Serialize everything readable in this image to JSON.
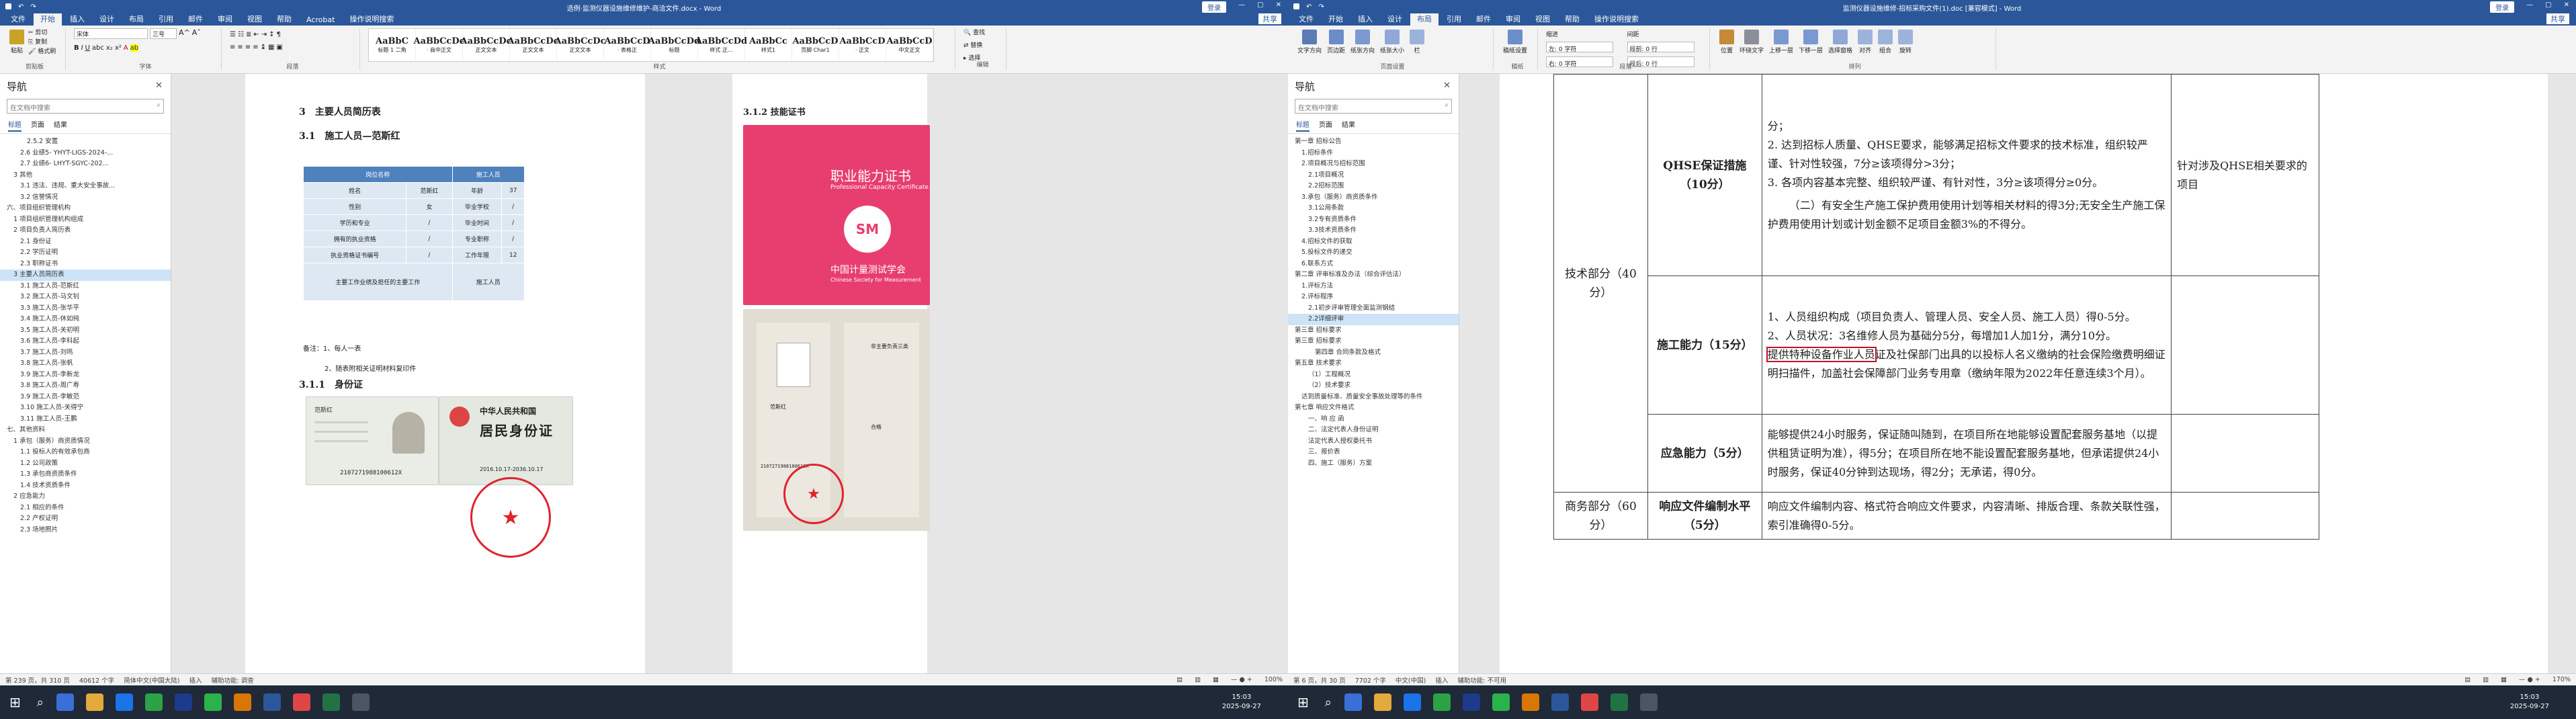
{
  "left": {
    "title": "选例·监测仪器设施维修维护-商洽文件.docx - Word",
    "login": "登录",
    "menu": [
      "文件",
      "开始",
      "插入",
      "设计",
      "布局",
      "引用",
      "邮件",
      "审阅",
      "视图",
      "帮助",
      "Acrobat",
      "操作说明搜索"
    ],
    "share": "共享",
    "ribbon": {
      "paste": "粘贴",
      "cut": "剪切",
      "copy": "复制",
      "painter": "格式刷",
      "font": "宋体",
      "size": "三号",
      "groups": [
        "剪贴板",
        "字体",
        "段落",
        "样式",
        "编辑"
      ],
      "styles": [
        [
          "AaBbC",
          "标题 1 二角"
        ],
        [
          "AaBbCcDc",
          "· 商中正文"
        ],
        [
          "AaBbCcDc",
          "正文文本"
        ],
        [
          "AaBbCcDc",
          "正文文本"
        ],
        [
          "AaBbCcDc",
          "正文文本"
        ],
        [
          "AaBbCcD",
          "· 表格正"
        ],
        [
          "AaBbCcDd",
          "标题"
        ],
        [
          "AaBbCcDd",
          "样式 正..."
        ],
        [
          "AaBbCc",
          "样式1"
        ],
        [
          "AaBbCcD",
          "页脚 Char1"
        ],
        [
          "AaBbCcD",
          "· 正文"
        ],
        [
          "AaBbCcD",
          "中文正文"
        ]
      ],
      "find": "查找",
      "replace": "替换",
      "select": "选择"
    },
    "nav": {
      "title": "导航",
      "search": "在文档中搜索",
      "tabs": [
        "标题",
        "页面",
        "结果"
      ],
      "items": [
        "2.5.2 安置",
        "2.6 业绩5- YHYT-LIGS-2024-...",
        "2.7 业绩6- LHYT-SGYC-202...",
        "3 其他",
        "3.1 违法、违规、重大安全事故...",
        "3.2 信誉情况",
        "六、项目组织管理机构",
        "1 项目组织管理机构组成",
        "2 项目负责人简历表",
        "2.1 身份证",
        "2.2 学历证明",
        "2.3 职称证书",
        "3 主要人员简历表",
        "3.1 施工人员-范斯红",
        "3.2 施工人员-马文钊",
        "3.3 施工人员-张华平",
        "3.4 施工人员-休如纯",
        "3.5 施工人员-关初明",
        "3.6 施工人员-李科起",
        "3.7 施工人员-刘鸣",
        "3.8 施工人员-张帆",
        "3.9 施工人员-李新龙",
        "3.8 施工人员-周广寿",
        "3.9 施工人员-李敏范",
        "3.10 施工人员-关得宁",
        "3.11 施工人员-王鹏",
        "七、其他资料",
        "1 承包（服务）商资质情况",
        "1.1 投标人的有效承包商",
        "1.2 公司政策",
        "1.3 承包商资质条件",
        "1.4 技术资质条件",
        "2 应急能力",
        "2.1 相应的条件",
        "2.2 产权证明",
        "2.3 场地照片"
      ]
    },
    "doc": {
      "h_main": "3　主要人员简历表",
      "h_sub": "3.1　施工人员—范斯红",
      "table": {
        "head": [
          "岗位名称",
          "施工人员"
        ],
        "rows": [
          [
            "姓名",
            "范斯红",
            "年龄",
            "37"
          ],
          [
            "性别",
            "女",
            "毕业学校",
            "/"
          ],
          [
            "学历和专业",
            "/",
            "毕业时间",
            "/"
          ],
          [
            "拥有的执业资格",
            "/",
            "专业职称",
            "/"
          ],
          [
            "执业资格证书编号",
            "/",
            "工作年限",
            "12"
          ]
        ],
        "last": [
          "主要工作业绩及担任的主要工作",
          "施工人员"
        ]
      },
      "note": "备注：1、每人一表",
      "note2": "2、随表附相关证明材料复印件",
      "h_id": "3.1.1　身份证",
      "id_card": {
        "name": "范斯红",
        "nation": "中华人民共和国",
        "title": "居民身份证",
        "id": "2107271988100612X",
        "period": "2016.10.17-2036.10.17"
      },
      "h_cert": "3.1.2 技能证书",
      "cert": {
        "title": "职业能力证书",
        "subtitle": "Professional Capacity Certificate",
        "org": "中国计量测试学会",
        "org_en": "Chinese Society for Measurement",
        "name": "范斯红",
        "type": "非主要负责三类",
        "grade": "合格",
        "no": "2107271988100612X"
      }
    },
    "status": {
      "page": "第 239 页，共 310 页",
      "words": "40612 个字",
      "lang": "简体中文(中国大陆)",
      "ins": "插入",
      "access": "辅助功能: 调查",
      "zoom": "100%"
    }
  },
  "right": {
    "title": "监测仪器设施维修-招标采购文件(1).doc [兼容模式] - Word",
    "menu": [
      "文件",
      "开始",
      "插入",
      "设计",
      "布局",
      "引用",
      "邮件",
      "审阅",
      "视图",
      "帮助",
      "操作说明搜索"
    ],
    "ribbon": {
      "groups": [
        "页面设置",
        "稿纸",
        "段落",
        "排列"
      ],
      "btns": [
        "文字方向",
        "页边距",
        "纸张方向",
        "纸张大小",
        "栏",
        "稿纸设置",
        "位置",
        "环绕文字",
        "上移一层",
        "下移一层",
        "选择窗格",
        "对齐",
        "组合",
        "旋转"
      ],
      "indent": "缩进",
      "spacing": "间距",
      "left": "左: 0 字符",
      "right": "右: 0 字符",
      "before": "段前: 0 行",
      "after": "段后: 0 行"
    },
    "nav": {
      "title": "导航",
      "search": "在文档中搜索",
      "tabs": [
        "标题",
        "页面",
        "结果"
      ],
      "items": [
        "第一章 招标公告",
        "1.招标条件",
        "2.项目概况与招标范围",
        "2.1项目概况",
        "2.2招标范围",
        "3.承包（服务）商资质条件",
        "3.1公用条款",
        "3.2专有资质条件",
        "3.3技术资质条件",
        "4.招标文件的获取",
        "5.投标文件的递交",
        "6.联系方式",
        "第二章 评审标准及办法（综合评估法）",
        "1.评标方法",
        "2.评标程序",
        "2.1初步评审管理全面监测钢结",
        "2.2详细评审",
        "第三章 招标要求",
        "第三章 招标要求",
        "第四章 合同条款及格式",
        "第五章 技术要求",
        "（1）工程概况",
        "（2）技术要求",
        "达到质量标准、质量安全事故处理等的条件",
        "第七章 响应文件格式",
        "一、响 应 函",
        "二、法定代表人身份证明",
        "法定代表人授权委托书",
        "三、报价表",
        "四、施工（服务）方案"
      ]
    },
    "doc": {
      "c_tech": "技术部分（40分）",
      "c_qhse": "QHSE保证措施（10分）",
      "qhse_text": [
        "分；",
        "2. 达到招标人质量、QHSE要求，能够满足招标文件要求的技术标准，组织较严谨、针对性较强，7分≥该项得分>3分；",
        "3. 各项内容基本完整、组织较严谨、有针对性，3分≥该项得分≥0分。",
        "（二）有安全生产施工保护费用使用计划等相关材料的得3分;无安全生产施工保护费用使用计划或计划金额不足项目金额3%的不得分。"
      ],
      "qhse_note": "针对涉及QHSE相关要求的项目",
      "c_ability": "施工能力（15分）",
      "ability_text": [
        "1、人员组织构成（项目负责人、管理人员、安全人员、施工人员）得0-5分。",
        "2、人员状况：3名维修人员为基础分5分，每增加1人加1分，满分10分。",
        "提供特种设备作业人员",
        "证及社保部门出具的以投标人名义缴纳的社会保险缴费明细证明扫描件，加盖社会保障部门业务专用章（缴纳年限为2022年任意连续3个月）。"
      ],
      "c_emerg": "应急能力（5分）",
      "emerg_text": "能够提供24小时服务，保证随叫随到，在项目所在地能够设置配套服务基地（以提供租赁证明为准），得5分；在项目所在地不能设置配套服务基地，但承诺提供24小时服务，保证40分钟到达现场，得2分；无承诺，得0分。",
      "c_biz": "商务部分（60分）",
      "c_resp": "响应文件编制水平（5分）",
      "resp_text": "响应文件编制内容、格式符合响应文件要求，内容清晰、排版合理、条款关联性强，索引准确得0-5分。"
    },
    "status": {
      "page": "第 6 页，共 30 页",
      "words": "7702 个字",
      "lang": "中文(中国)",
      "ins": "插入",
      "access": "辅助功能: 不可用",
      "zoom": "170%"
    }
  },
  "taskbar": {
    "time": "15:03",
    "date": "2025-09-27"
  }
}
